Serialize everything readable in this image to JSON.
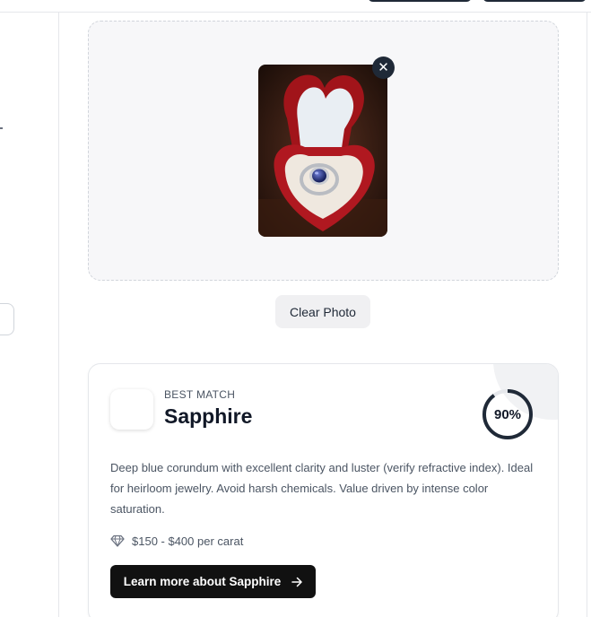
{
  "upload": {
    "remove_icon": "close-icon",
    "clear_label": "Clear Photo"
  },
  "result": {
    "eyebrow": "BEST MATCH",
    "name": "Sapphire",
    "confidence_label": "90%",
    "confidence_fraction": 0.9,
    "description": "Deep blue corundum with excellent clarity and luster (verify refractive index). Ideal for heirloom jewelry. Avoid harsh chemicals. Value driven by intense color saturation.",
    "price": "$150 - $400 per carat",
    "price_icon": "diamond-icon",
    "cta_label": "Learn more about Sapphire",
    "cta_icon": "arrow-right-icon"
  },
  "colors": {
    "accent": "#1f2937",
    "ring_track": "#e5e7eb",
    "cta_bg": "#111111"
  }
}
